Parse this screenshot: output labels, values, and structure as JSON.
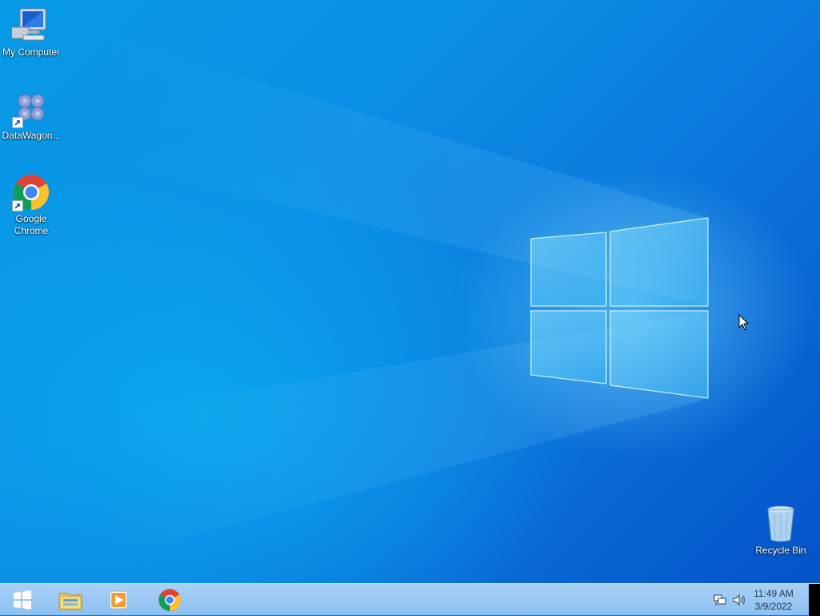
{
  "desktop": {
    "icons": [
      {
        "label": "My Computer",
        "icon": "computer-icon"
      },
      {
        "label": "DataWagon...",
        "icon": "gear-cluster-icon"
      },
      {
        "label": "Google\nChrome",
        "icon": "chrome-icon"
      },
      {
        "label": "Recycle Bin",
        "icon": "recycle-bin-icon"
      }
    ]
  },
  "taskbar": {
    "pinned": [
      {
        "icon": "windows-start-icon"
      },
      {
        "icon": "file-explorer-icon"
      },
      {
        "icon": "media-player-icon"
      },
      {
        "icon": "chrome-icon"
      }
    ],
    "tray": {
      "network_icon": "network-icon",
      "volume_icon": "volume-icon",
      "time": "11:49 AM",
      "date": "3/9/2022"
    }
  },
  "colors": {
    "wallpaper_accent": "#0a8fe4",
    "taskbar": "#a9d0f5"
  }
}
